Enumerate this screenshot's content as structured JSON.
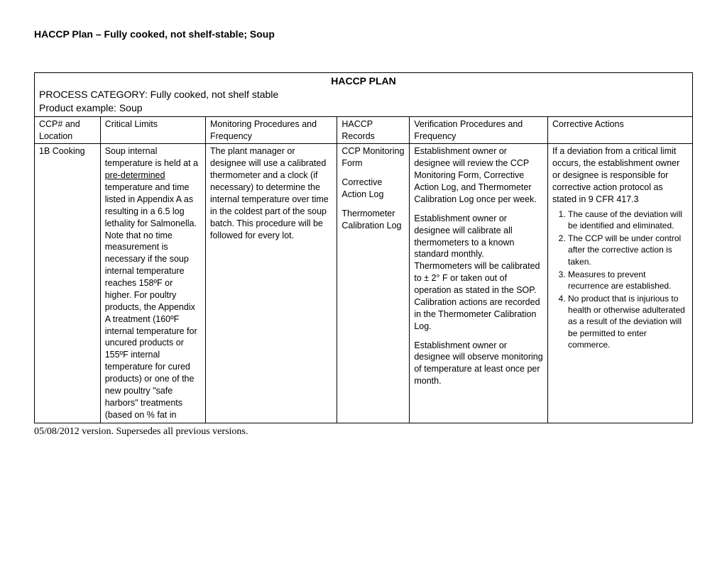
{
  "doc_title": "HACCP Plan – Fully cooked, not shelf-stable;  Soup",
  "table_title": "HACCP PLAN",
  "process_category": "PROCESS CATEGORY: Fully cooked, not shelf stable",
  "product_example": "Product example: Soup",
  "headers": {
    "ccp": "CCP# and Location",
    "limits": "Critical Limits",
    "monitoring": "Monitoring Procedures and Frequency",
    "records": "HACCP Records",
    "verification": "Verification Procedures and Frequency",
    "corrective": "Corrective Actions"
  },
  "row": {
    "ccp": "1B Cooking",
    "limits_pre": "Soup internal temperature is held at a ",
    "limits_underlined": "pre-determined",
    "limits_post": " temperature and time listed in Appendix A as resulting in a 6.5 log lethality for Salmonella.  Note that no time measurement is necessary if the soup internal temperature reaches 158ºF or higher. For poultry products, the Appendix A treatment (160ºF internal temperature for uncured products or 155ºF internal temperature for cured products) or one of the new poultry \"safe harbors\" treatments (based on % fat in",
    "monitoring": "The plant manager or designee will use a calibrated thermometer and a clock (if necessary) to determine the internal temperature over time in the coldest part of the soup batch.   This procedure will be followed for every lot.",
    "records_1": "CCP Monitoring Form",
    "records_2": "Corrective Action Log",
    "records_3": "Thermometer Calibration Log",
    "verification_1": "Establishment owner or designee will review the CCP Monitoring Form, Corrective Action Log, and Thermometer Calibration Log once per week.",
    "verification_2": "Establishment owner or designee will calibrate all thermometers to a known standard monthly.  Thermometers will be calibrated to ± 2° F or taken out of operation as stated in the SOP.  Calibration actions are recorded in the Thermometer Calibration Log.",
    "verification_3": "Establishment owner or designee will observe monitoring of temperature at least once per month.",
    "corrective_intro": "If a deviation from a critical limit occurs, the establishment owner or designee is responsible for corrective action protocol as stated in 9 CFR 417.3",
    "corrective_list": [
      "The cause of the deviation will be identified and eliminated.",
      "The CCP will be under control after the corrective action is taken.",
      "Measures to prevent recurrence are established.",
      "No product that is injurious to health or otherwise adulterated as a result of the deviation will be permitted to enter commerce."
    ]
  },
  "footer": "05/08/2012 version.  Supersedes all previous versions."
}
